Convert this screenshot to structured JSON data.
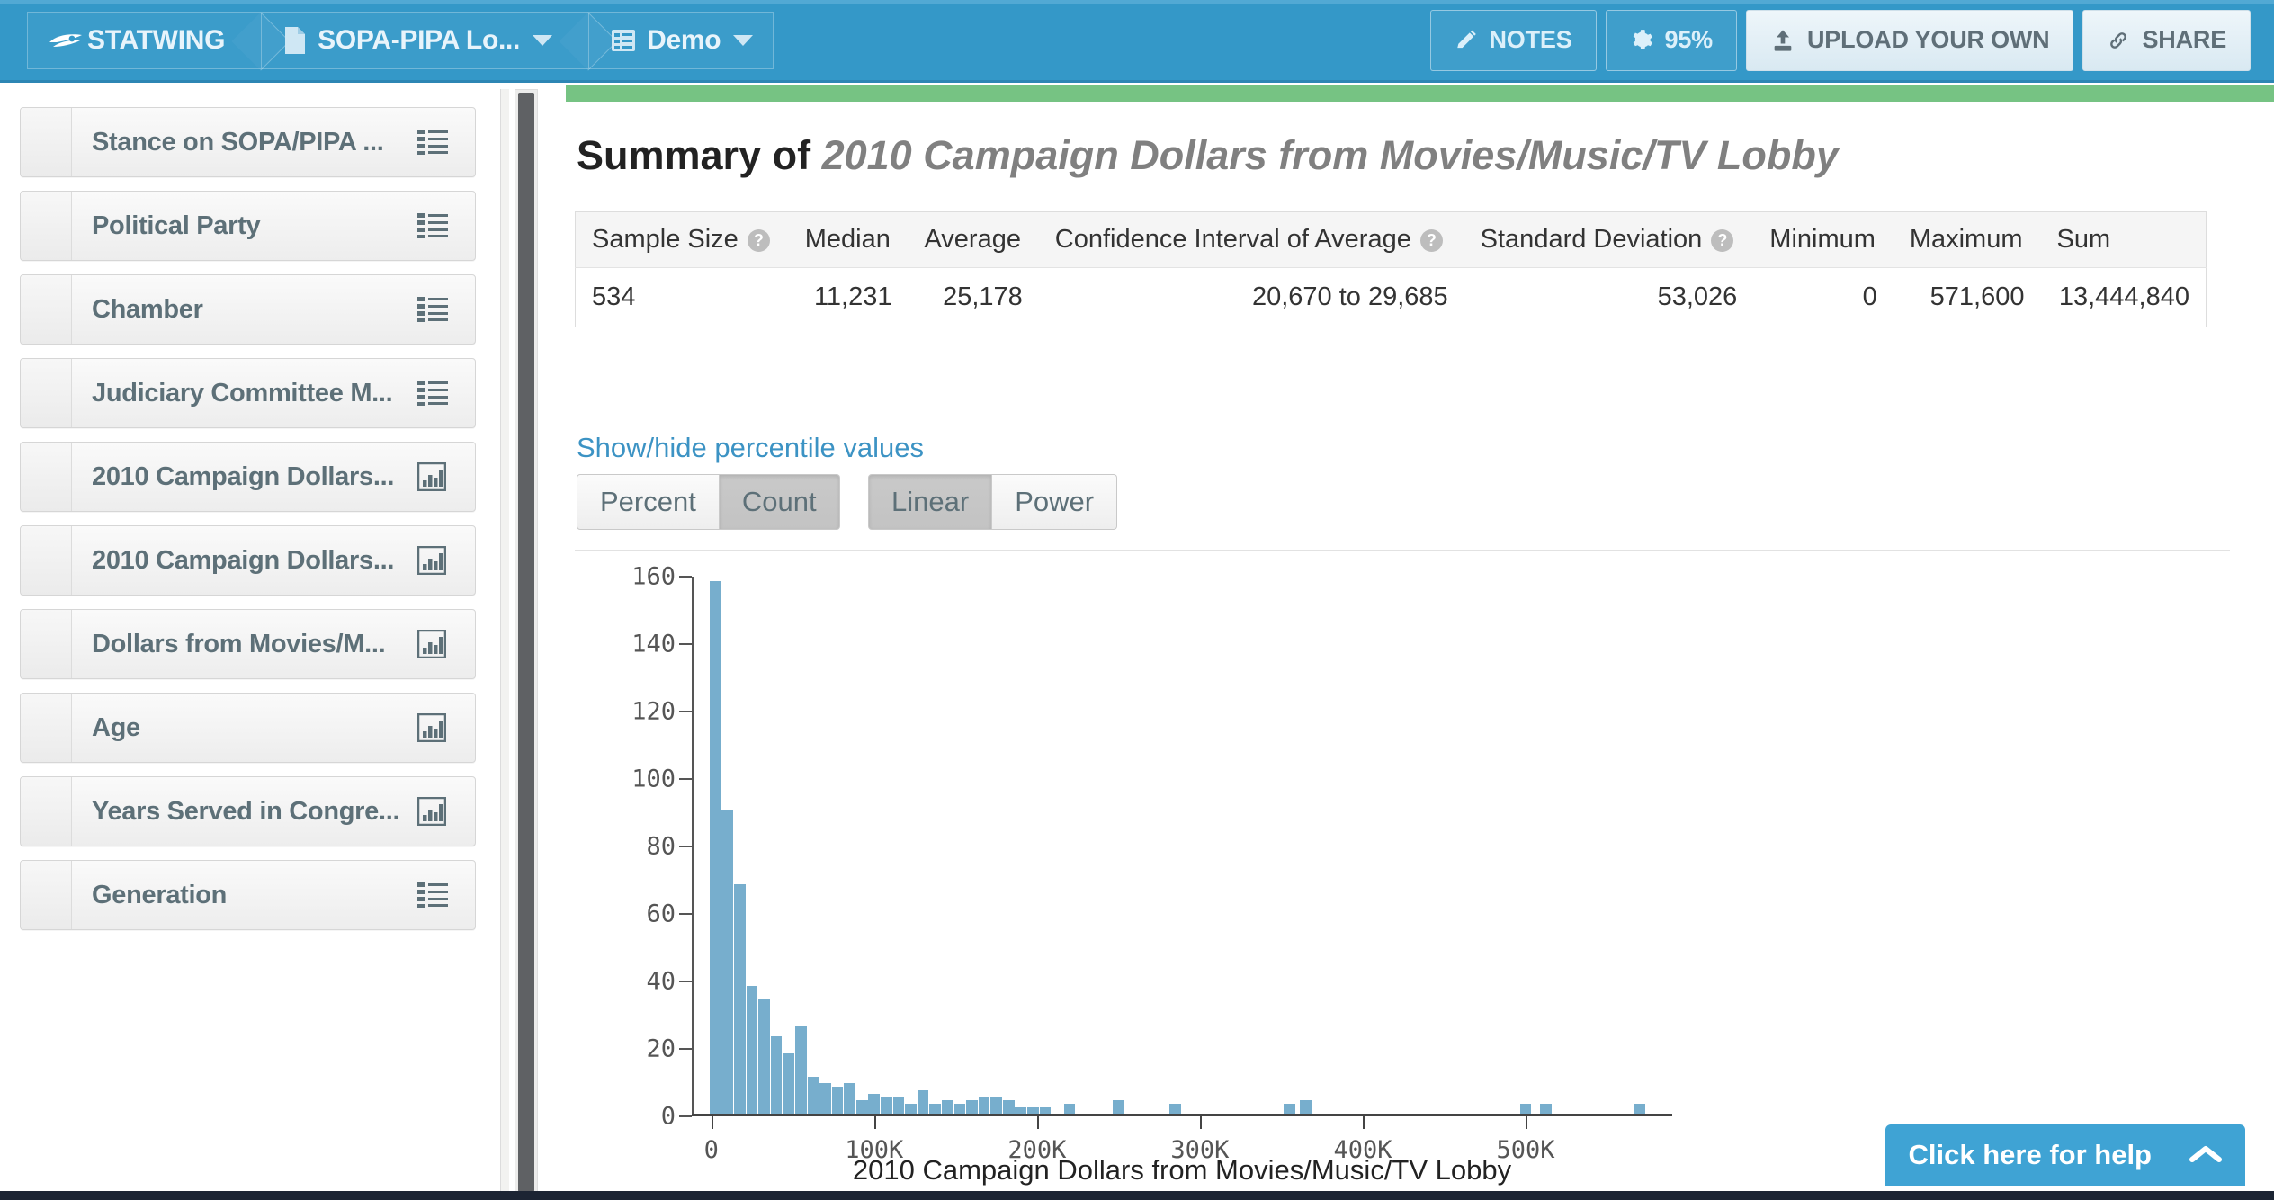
{
  "topbar": {
    "brand": "STATWING",
    "brand_icon": "wing-logo-icon",
    "breadcrumbs": [
      {
        "label": "SOPA-PIPA Lo...",
        "icon": "document-icon",
        "has_caret": true
      },
      {
        "label": "Demo",
        "icon": "list-view-icon",
        "has_caret": true
      }
    ],
    "buttons": [
      {
        "label": "NOTES",
        "icon": "pencil-icon",
        "style": "ghost"
      },
      {
        "label": "95%",
        "icon": "gear-icon",
        "style": "ghost"
      },
      {
        "label": "UPLOAD YOUR OWN",
        "icon": "upload-icon",
        "style": "light"
      },
      {
        "label": "SHARE",
        "icon": "link-icon",
        "style": "light"
      }
    ],
    "bg_color": "#3498c8"
  },
  "sidebar": {
    "items": [
      {
        "label": "Stance on SOPA/PIPA ...",
        "icon": "list-icon"
      },
      {
        "label": "Political Party",
        "icon": "list-icon"
      },
      {
        "label": "Chamber",
        "icon": "list-icon"
      },
      {
        "label": "Judiciary Committee M...",
        "icon": "list-icon"
      },
      {
        "label": "2010 Campaign Dollars...",
        "icon": "bar-chart-icon"
      },
      {
        "label": "2010 Campaign Dollars...",
        "icon": "bar-chart-icon"
      },
      {
        "label": "Dollars from Movies/M...",
        "icon": "bar-chart-icon"
      },
      {
        "label": "Age",
        "icon": "bar-chart-icon"
      },
      {
        "label": "Years Served in Congre...",
        "icon": "bar-chart-icon"
      },
      {
        "label": "Generation",
        "icon": "list-icon"
      }
    ]
  },
  "main": {
    "title_prefix": "Summary of ",
    "title_variable": "2010 Campaign Dollars from Movies/Music/TV Lobby",
    "accent_green": "#76c383",
    "summary_table": {
      "headers": [
        {
          "label": "Sample Size",
          "help": true
        },
        {
          "label": "Median",
          "help": false
        },
        {
          "label": "Average",
          "help": false
        },
        {
          "label": "Confidence Interval of Average",
          "help": true
        },
        {
          "label": "Standard Deviation",
          "help": true
        },
        {
          "label": "Minimum",
          "help": false
        },
        {
          "label": "Maximum",
          "help": false
        },
        {
          "label": "Sum",
          "help": false
        }
      ],
      "row": [
        "534",
        "11,231",
        "25,178",
        "20,670 to 29,685",
        "53,026",
        "0",
        "571,600",
        "13,444,840"
      ]
    },
    "percentile_link": "Show/hide percentile values",
    "toggle_groups": [
      {
        "name": "value-mode",
        "options": [
          {
            "label": "Percent",
            "active": false
          },
          {
            "label": "Count",
            "active": true
          }
        ]
      },
      {
        "name": "scale-mode",
        "options": [
          {
            "label": "Linear",
            "active": true
          },
          {
            "label": "Power",
            "active": false
          }
        ]
      }
    ]
  },
  "help": {
    "label": "Click here for help",
    "icon": "chevron-up-icon",
    "color": "#3fa3d4"
  },
  "chart_data": {
    "type": "bar",
    "title": "",
    "xlabel": "2010 Campaign Dollars from Movies/Music/TV Lobby",
    "ylabel": "",
    "grid": false,
    "legend": "none",
    "xlim": [
      -12000,
      590000
    ],
    "ylim": [
      0,
      160
    ],
    "yticks": [
      0,
      20,
      40,
      60,
      80,
      100,
      120,
      140,
      160
    ],
    "xticks": [
      0,
      100000,
      200000,
      300000,
      400000,
      500000
    ],
    "xticklabels": [
      "0",
      "100K",
      "200K",
      "300K",
      "400K",
      "500K"
    ],
    "bin_width": 10000,
    "bar_color": "#77aecd",
    "x": [
      2500,
      10000,
      17500,
      25000,
      32500,
      40000,
      47500,
      55000,
      62500,
      70000,
      77500,
      85000,
      92500,
      100000,
      107500,
      115000,
      122500,
      130000,
      137500,
      145000,
      152500,
      160000,
      167500,
      175000,
      182500,
      190000,
      197500,
      205000,
      212500,
      220000,
      227500,
      235000,
      242500,
      250000,
      260000,
      285000,
      355000,
      365000,
      500000,
      512500,
      570000
    ],
    "values": [
      158,
      90,
      68,
      38,
      34,
      23,
      18,
      26,
      11,
      9,
      8,
      9,
      4,
      6,
      5,
      5,
      3,
      7,
      3,
      4,
      3,
      4,
      5,
      5,
      4,
      2,
      2,
      2,
      0,
      3,
      0,
      0,
      0,
      4,
      0,
      3,
      3,
      4,
      3,
      3,
      3
    ]
  }
}
